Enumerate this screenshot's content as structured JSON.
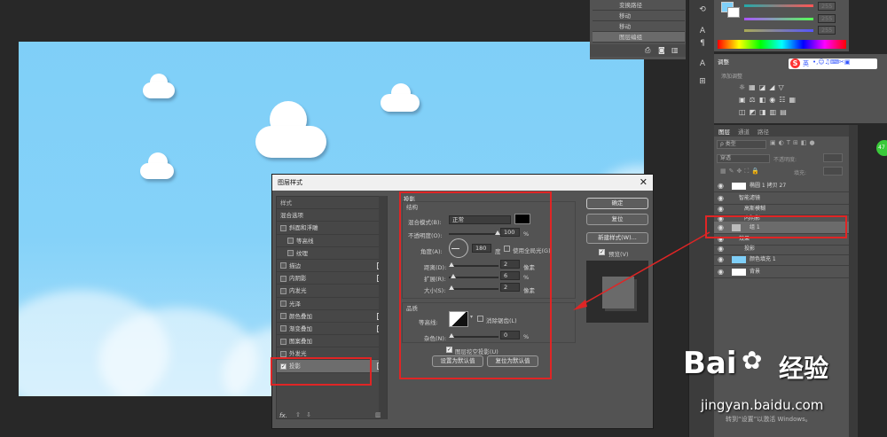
{
  "history": {
    "items": [
      "变换路径",
      "移动",
      "移动",
      "图层编组"
    ],
    "selected_index": 3
  },
  "adjust": {
    "tab": "调整",
    "subtitle": "添加调整",
    "ime_label": "英",
    "ime_logo": "S"
  },
  "color": {
    "r": "255",
    "g": "255",
    "b": "255"
  },
  "layers": {
    "tabs": [
      "图层",
      "通道",
      "路径"
    ],
    "filter_kind": "ρ 类型",
    "blend_mode": "穿透",
    "opacity_label": "不透明度:",
    "fill_label": "填充:",
    "rows": [
      {
        "name": "椭圆 1 拷贝 27",
        "indent": 0
      },
      {
        "name": "智能滤镜",
        "indent": 1
      },
      {
        "name": "高斯模糊",
        "indent": 2
      },
      {
        "name": "内阴影",
        "indent": 2
      },
      {
        "name": "组 1",
        "indent": 0
      },
      {
        "name": "效果",
        "indent": 1
      },
      {
        "name": "投影",
        "indent": 2
      },
      {
        "name": "颜色填充 1",
        "indent": 0
      },
      {
        "name": "背景",
        "indent": 0
      }
    ]
  },
  "dialog": {
    "title": "图层样式",
    "left": {
      "header": "样式",
      "blend_options": "混合选项",
      "items": [
        {
          "label": "斜面和浮雕",
          "check": true,
          "plus": false,
          "indent": false
        },
        {
          "label": "等高线",
          "check": true,
          "plus": false,
          "indent": true
        },
        {
          "label": "纹理",
          "check": true,
          "plus": false,
          "indent": true
        },
        {
          "label": "描边",
          "check": true,
          "plus": true,
          "indent": false
        },
        {
          "label": "内阴影",
          "check": true,
          "plus": true,
          "indent": false
        },
        {
          "label": "内发光",
          "check": true,
          "plus": false,
          "indent": false
        },
        {
          "label": "光泽",
          "check": true,
          "plus": false,
          "indent": false
        },
        {
          "label": "颜色叠加",
          "check": true,
          "plus": true,
          "indent": false
        },
        {
          "label": "渐变叠加",
          "check": true,
          "plus": true,
          "indent": false
        },
        {
          "label": "图案叠加",
          "check": true,
          "plus": false,
          "indent": false
        },
        {
          "label": "外发光",
          "check": true,
          "plus": false,
          "indent": false
        },
        {
          "label": "投影",
          "check": true,
          "plus": true,
          "indent": false
        }
      ],
      "fx": "fx."
    },
    "shadow": {
      "section": "投影",
      "structure": "结构",
      "blend_mode_label": "混合模式(B):",
      "blend_mode_value": "正常",
      "opacity_label": "不透明度(O):",
      "opacity_value": "100",
      "angle_label": "角度(A):",
      "angle_value": "180",
      "angle_unit": "度",
      "global_light": "使用全局光(G)",
      "distance_label": "距离(D):",
      "distance_value": "2",
      "spread_label": "扩展(R):",
      "spread_value": "6",
      "size_label": "大小(S):",
      "size_value": "2",
      "px_unit": "像素",
      "pct": "%",
      "quality": "品质",
      "contour_label": "等高线:",
      "antialias": "消除锯齿(L)",
      "noise_label": "杂色(N):",
      "noise_value": "0",
      "knockout": "图层挖空投影(U)",
      "make_default": "设置为默认值",
      "reset_default": "复位为默认值"
    },
    "buttons": {
      "ok": "确定",
      "reset": "复位",
      "new_style": "新建样式(W)...",
      "preview": "预览(V)"
    }
  },
  "watermark": {
    "brand_left": "Bai",
    "brand_right": "经验",
    "url": "jingyan.baidu.com",
    "activate": "转到“设置”以激活 Windows。"
  },
  "badge": "47"
}
